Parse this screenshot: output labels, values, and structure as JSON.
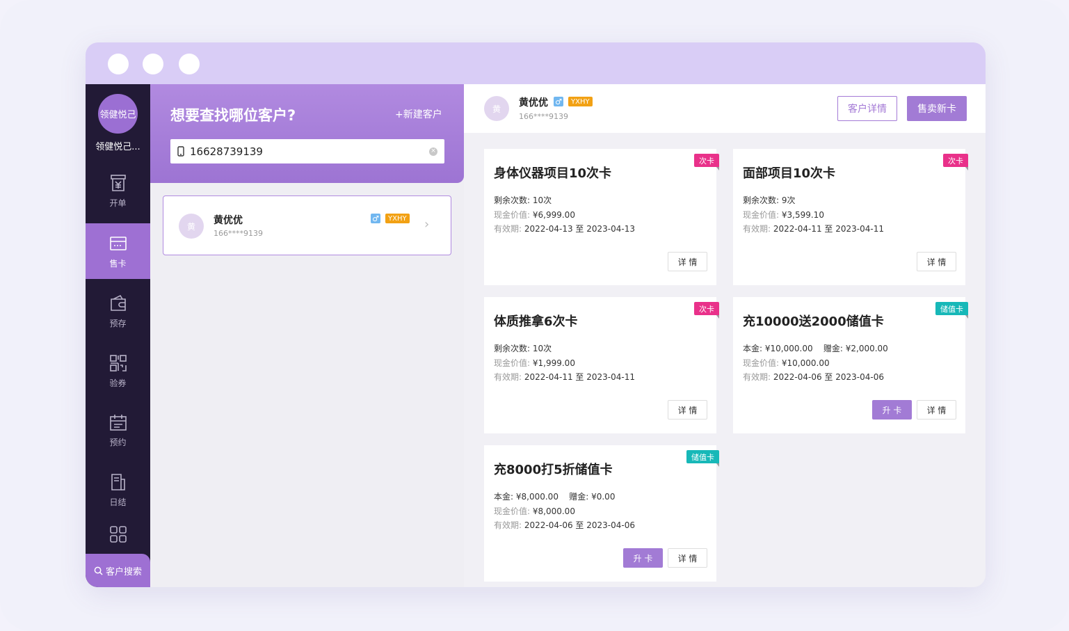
{
  "window": {
    "controls": [
      "close",
      "minimize",
      "maximize"
    ]
  },
  "sidebar": {
    "store_avatar_text": "领健悦己",
    "store_name": "领健悦己...",
    "items": [
      {
        "label": "开单",
        "icon": "receipt-icon",
        "active": false
      },
      {
        "label": "售卡",
        "icon": "card-icon",
        "active": true
      },
      {
        "label": "预存",
        "icon": "wallet-icon",
        "active": false
      },
      {
        "label": "验券",
        "icon": "qrcode-icon",
        "active": false
      },
      {
        "label": "预约",
        "icon": "calendar-icon",
        "active": false
      },
      {
        "label": "日结",
        "icon": "report-icon",
        "active": false
      },
      {
        "label": "",
        "icon": "apps-grid-icon",
        "active": false
      }
    ],
    "search_button": "客户搜索"
  },
  "search_panel": {
    "title": "想要查找哪位客户?",
    "new_customer": "+新建客户",
    "search_value": "16628739139",
    "results": [
      {
        "avatar": "黄",
        "name": "黄优优",
        "phone": "166****9139",
        "gender": "♂",
        "level": "YXHY"
      }
    ]
  },
  "detail": {
    "customer": {
      "avatar": "黄",
      "name": "黄优优",
      "phone": "166****9139",
      "gender": "♂",
      "level": "YXHY"
    },
    "details_button": "客户详情",
    "sell_button": "售卖新卡"
  },
  "cards": [
    {
      "title": "身体仪器项目10次卡",
      "tag": "次卡",
      "tag_color": "#e9318a",
      "line1_label": "剩余次数:",
      "line1_value": "10次",
      "line2_label": "现金价值:",
      "line2_value": "¥6,999.00",
      "line3_label": "有效期:",
      "line3_value": "2022-04-13 至 2023-04-13",
      "detail_btn": "详 情"
    },
    {
      "title": "面部项目10次卡",
      "tag": "次卡",
      "tag_color": "#e9318a",
      "line1_label": "剩余次数:",
      "line1_value": "9次",
      "line2_label": "现金价值:",
      "line2_value": "¥3,599.10",
      "line3_label": "有效期:",
      "line3_value": "2022-04-11 至 2023-04-11",
      "detail_btn": "详 情"
    },
    {
      "title": "体质推拿6次卡",
      "tag": "次卡",
      "tag_color": "#e9318a",
      "line1_label": "剩余次数:",
      "line1_value": "10次",
      "line2_label": "现金价值:",
      "line2_value": "¥1,999.00",
      "line3_label": "有效期:",
      "line3_value": "2022-04-11 至 2023-04-11",
      "detail_btn": "详 情"
    },
    {
      "title": "充10000送2000储值卡",
      "tag": "储值卡",
      "tag_color": "#17b8b8",
      "line1_label": "本金:",
      "line1_value": "¥10,000.00",
      "line1b_label": "赠金:",
      "line1b_value": "¥2,000.00",
      "line2_label": "现金价值:",
      "line2_value": "¥10,000.00",
      "line3_label": "有效期:",
      "line3_value": "2022-04-06 至 2023-04-06",
      "upgrade_btn": "升 卡",
      "detail_btn": "详 情"
    },
    {
      "title": "充8000打5折储值卡",
      "tag": "储值卡",
      "tag_color": "#17b8b8",
      "line1_label": "本金:",
      "line1_value": "¥8,000.00",
      "line1b_label": "赠金:",
      "line1b_value": "¥0.00",
      "line2_label": "现金价值:",
      "line2_value": "¥8,000.00",
      "line3_label": "有效期:",
      "line3_value": "2022-04-06 至 2023-04-06",
      "upgrade_btn": "升 卡",
      "detail_btn": "详 情"
    }
  ]
}
